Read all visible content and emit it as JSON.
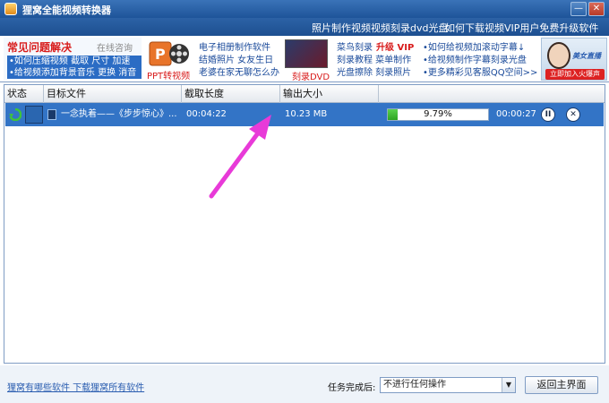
{
  "window": {
    "title": "狸窝全能视频转换器",
    "minimize_glyph": "—",
    "close_glyph": "✕"
  },
  "menubar": {
    "items": [
      "照片制作视频",
      "视频刻录dvd光盘",
      "如何下载视频",
      "VIP用户免费升级软件"
    ]
  },
  "ads": {
    "faq": {
      "title": "常见问题解决",
      "online": "在线咨询",
      "line1": "•如何压缩视频  截取  尺寸  加速",
      "line2": "•给视频添加背景音乐  更换  消音"
    },
    "ppt": {
      "label": "PPT转视频",
      "link1": "电子相册制作软件",
      "link2": "结婚照片  女友生日",
      "link3": "老婆在家无聊怎么办"
    },
    "dvd": {
      "label": "刻录DVD",
      "link1_a": "菜鸟刻录",
      "link1_b": "升级 VIP",
      "link2": "刻录教程  菜单制作",
      "link3": "光盘擦除  刻录照片"
    },
    "tips": {
      "link1": "•如何给视频加滚动字幕↓",
      "link2": "•给视频制作字幕刻录光盘",
      "link3": "•更多精彩见客服QQ空间>>"
    },
    "portrait": {
      "text": "美女直播",
      "button": "立即加入火爆声"
    }
  },
  "list": {
    "headers": {
      "status": "状态",
      "target": "目标文件",
      "duration": "截取长度",
      "size": "输出大小"
    },
    "rows": [
      {
        "filename": "一念执着——《步步惊心》...",
        "duration": "00:04:22",
        "size": "10.23 MB",
        "progress_text": "9.79%",
        "progress_value": 0.0979,
        "remaining": "00:00:27",
        "pause_glyph": "II",
        "cancel_glyph": "✕"
      }
    ]
  },
  "bottom": {
    "link": "狸窝有哪些软件 下载狸窝所有软件",
    "after_label": "任务完成后:",
    "after_value": "不进行任何操作",
    "main_button": "返回主界面"
  },
  "colors": {
    "title_blue": "#1e5499",
    "row_blue": "#3374c6",
    "progress_green": "#2ea422",
    "arrow_magenta": "#e83ad8",
    "accent_red": "#d81b1b"
  }
}
